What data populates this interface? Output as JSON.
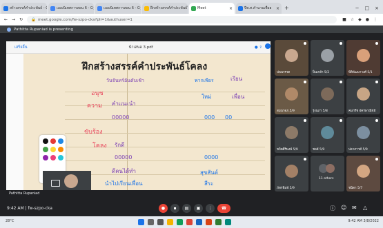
{
  "browser": {
    "tabs": [
      {
        "label": "สร้างสรรค์คำประพันธ์ - Goo",
        "color": "#1a73e8"
      },
      {
        "label": "แบบนิเทศการสอน 6 - G",
        "color": "#4285f4"
      },
      {
        "label": "แบบนิเทศการสอน 6 - G",
        "color": "#4285f4"
      },
      {
        "label": "ฝึกสร้างสรรค์คำประพันธ์โ",
        "color": "#fbbc04"
      },
      {
        "label": "Meet",
        "color": "#34a853",
        "active": true
      },
      {
        "label": "ปีพ.ศ.คำนามเพื่อย",
        "color": "#1a73e8"
      }
    ],
    "window_controls": [
      "−",
      "□",
      "×"
    ],
    "url": "meet.google.com/fw-szpo-cka?pli=1&authuser=1"
  },
  "presenting_banner": "Pathitta Rupaniad is presenting",
  "slide": {
    "toolbar_left": "เสร็จสิ้น",
    "file_name": "นำเสนอ 3.pdf",
    "title": "ฝึกสร้างสรรค์คำประพันธ์โคลง",
    "author_line": "วันจันทร์อันดับเช้า",
    "mark_ch": "พากเพียร",
    "notes": [
      "อนุช",
      "ความ",
      "คำแนะนำ",
      "ขับร้อง",
      "โคลง",
      "รักดี",
      "เรียน",
      "เพื่อน",
      "ใหม่",
      "00000",
      "000",
      "00",
      "00000",
      "0000",
      "ดีคนได้ทำ",
      "สุขสันต์",
      "นำไปเรียนเพื่อน",
      "สีระ"
    ]
  },
  "stage_footer": "Pathitta Rupaniad",
  "participants": [
    {
      "name": "ปพนวรวด",
      "bg": "#5a4a3a",
      "av": "#c9a88f"
    },
    {
      "name": "ปิ่นเกล้า 5/2",
      "bg": "#3c4043",
      "av": "#9aa0a6"
    },
    {
      "name": "ปีติพัฒนาวงศ์ 5/1",
      "bg": "#4f3b33",
      "av": "#d9a07a"
    },
    {
      "name": "สมนาดภ.5/9",
      "bg": "#6b5a46",
      "av": "#b08968"
    },
    {
      "name": "รุ่งนภา 5/8",
      "bg": "#3c4043",
      "av": "#7d6a5a"
    },
    {
      "name": "คมกริช อัครพาณิชย์",
      "bg": "#3c4043",
      "av": "#c7a585"
    },
    {
      "name": "ขจิตศิริพงษ์ 5/9",
      "bg": "#3c4043",
      "av": "#8d7a68"
    },
    {
      "name": "ชลลี 5/9",
      "bg": "#3c4043",
      "av": "#5f8a9a"
    },
    {
      "name": "ปลาภาวดี 5/9",
      "bg": "#3c4043",
      "av": "#7c8fa0"
    },
    {
      "name": "ภัทรพิมพ์ 5/9",
      "bg": "#3c4043",
      "av": "#a38066"
    },
    {
      "name": "11 others",
      "bg": "#3c4043",
      "av": "#5f6368"
    },
    {
      "name": "ชนิดา 5/7",
      "bg": "#5d4a40",
      "av": "#d3a682"
    }
  ],
  "meeting": {
    "time_code": "9:42 AM | fw-szpo-cka",
    "controls": [
      "mic-off",
      "camera",
      "captions",
      "present",
      "more"
    ],
    "end_call": "end-call",
    "right_controls": [
      "info",
      "people",
      "chat",
      "activities"
    ]
  },
  "taskbar": {
    "weather": "28°C",
    "tray_time": "9:42 AM",
    "tray_date": "3/8/2022"
  },
  "colors": {
    "accent": "#1a73e8",
    "end_call": "#ea4335",
    "meet_bg": "#202124"
  }
}
